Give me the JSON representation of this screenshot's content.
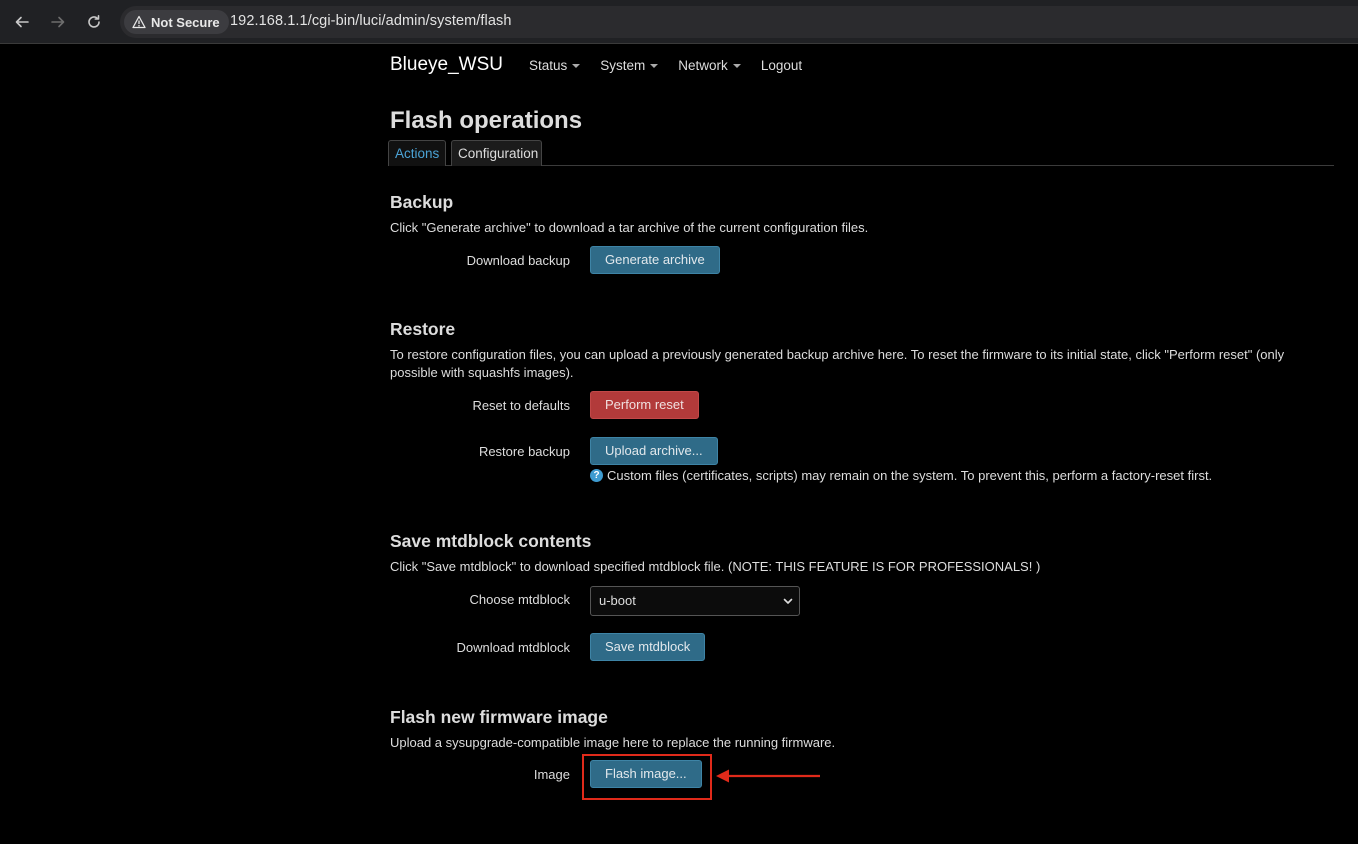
{
  "browser": {
    "security_label": "Not Secure",
    "url": "192.168.1.1/cgi-bin/luci/admin/system/flash"
  },
  "header": {
    "brand": "Blueye_WSU",
    "menu": [
      {
        "label": "Status",
        "has_dropdown": true
      },
      {
        "label": "System",
        "has_dropdown": true
      },
      {
        "label": "Network",
        "has_dropdown": true
      },
      {
        "label": "Logout",
        "has_dropdown": false
      }
    ]
  },
  "page": {
    "title": "Flash operations",
    "tabs": [
      {
        "label": "Actions",
        "active": true
      },
      {
        "label": "Configuration",
        "active": false
      }
    ]
  },
  "backup": {
    "title": "Backup",
    "description": "Click \"Generate archive\" to download a tar archive of the current configuration files.",
    "download_label": "Download backup",
    "generate_button": "Generate archive"
  },
  "restore": {
    "title": "Restore",
    "description": "To restore configuration files, you can upload a previously generated backup archive here. To reset the firmware to its initial state, click \"Perform reset\" (only possible with squashfs images).",
    "reset_label": "Reset to defaults",
    "reset_button": "Perform reset",
    "restore_label": "Restore backup",
    "upload_button": "Upload archive...",
    "hint": "Custom files (certificates, scripts) may remain on the system. To prevent this, perform a factory-reset first."
  },
  "mtdblock": {
    "title": "Save mtdblock contents",
    "description": "Click \"Save mtdblock\" to download specified mtdblock file. (NOTE: THIS FEATURE IS FOR PROFESSIONALS! )",
    "choose_label": "Choose mtdblock",
    "selected": "u-boot",
    "download_label": "Download mtdblock",
    "save_button": "Save mtdblock"
  },
  "firmware": {
    "title": "Flash new firmware image",
    "description": "Upload a sysupgrade-compatible image here to replace the running firmware.",
    "image_label": "Image",
    "flash_button": "Flash image..."
  },
  "colors": {
    "primary_button": "#2f6b88",
    "danger_button": "#b23a3a",
    "active_tab": "#4ba3d6",
    "annotation": "#e02a1a"
  }
}
